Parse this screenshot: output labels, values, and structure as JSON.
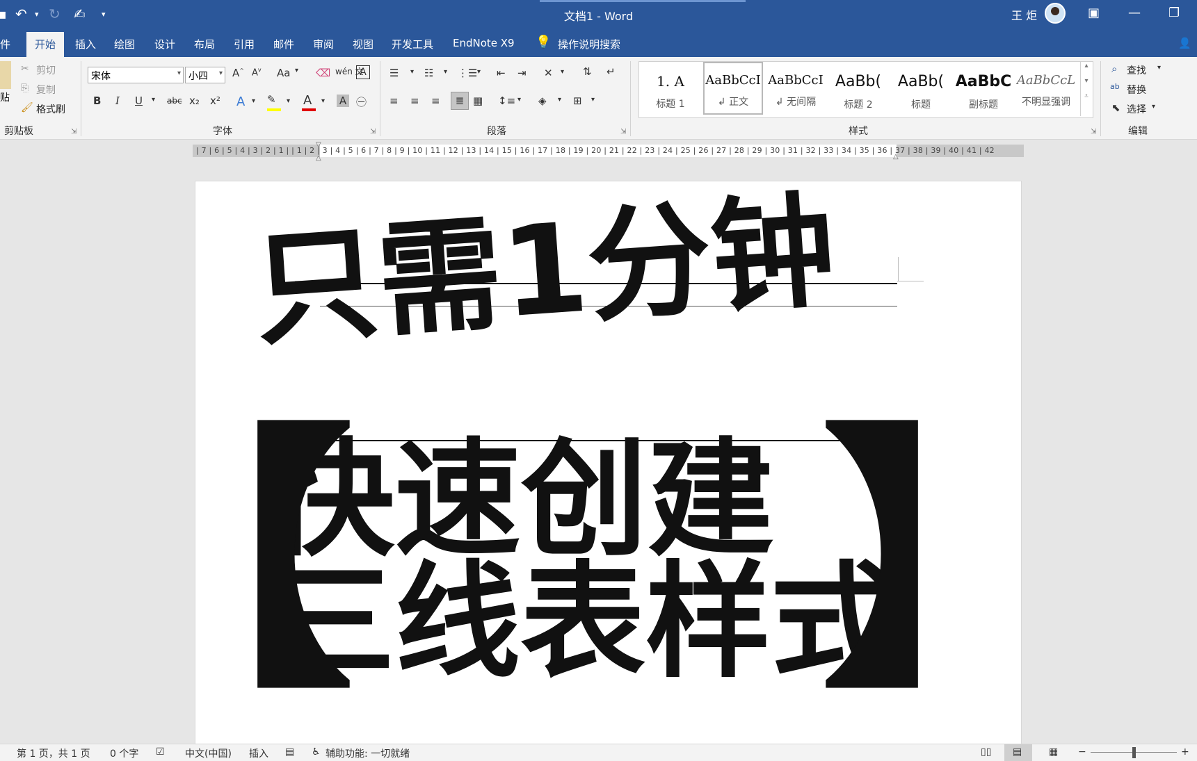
{
  "titlebar": {
    "doc_title": "文档1  -  Word",
    "user_name": "王 炬",
    "qa_save_icon": "save-icon",
    "qa_undo_icon": "undo-icon",
    "qa_redo_icon": "redo-icon",
    "qa_touch_icon": "touch-mode-icon",
    "qa_more": "▾",
    "min_glyph": "—",
    "restore_glyph": "❐"
  },
  "tabs": [
    "件",
    "开始",
    "插入",
    "绘图",
    "设计",
    "布局",
    "引用",
    "邮件",
    "审阅",
    "视图",
    "开发工具",
    "EndNote X9",
    "操作说明搜索"
  ],
  "clipboard": {
    "paste": "贴",
    "cut": "剪切",
    "copy": "复制",
    "format_painter": "格式刷",
    "label": "剪贴板"
  },
  "font": {
    "name": "宋体",
    "size": "小四",
    "label": "字体",
    "grow": "A",
    "shrink": "A",
    "case": "Aa",
    "bold": "B",
    "italic": "I",
    "underline": "U",
    "strike": "abc",
    "sub": "x₂",
    "sup": "x²",
    "color_a": "A",
    "shade_a": "A",
    "border_a": "A",
    "phonetic": "wén 文",
    "enclose": "㊀"
  },
  "paragraph": {
    "label": "段落"
  },
  "styles": {
    "label": "样式",
    "items": [
      {
        "sample": "1.   A",
        "name": "标题 1"
      },
      {
        "sample": "AaBbCcI",
        "name": "↲ 正文"
      },
      {
        "sample": "AaBbCcI",
        "name": "↲ 无间隔"
      },
      {
        "sample": "AaBb(",
        "name": "标题 2"
      },
      {
        "sample": "AaBb(",
        "name": "标题"
      },
      {
        "sample": "AaBbC",
        "name": "副标题"
      },
      {
        "sample": "AaBbCcL",
        "name": "不明显强调"
      }
    ]
  },
  "editing": {
    "find": "查找",
    "replace": "替换",
    "select": "选择",
    "label": "编辑"
  },
  "ruler": {
    "text": "| 7 | 6 | 5 | 4 | 3 | 2 | 1 |   | 1 | 2 | 3 | 4 | 5 | 6 | 7 | 8 | 9 | 10 | 11 | 12 | 13 | 14 | 15 | 16 | 17 | 18 | 19 | 20 | 21 | 22 | 23 | 24 | 25 | 26 | 27 | 28 | 29 | 30 | 31 | 32 | 33 | 34 | 35 | 36 | 37 | 38 | 39 | 40 | 41 | 42"
  },
  "document": {
    "line1": "只需1分钟",
    "line2": "快速创建",
    "line3": "三线表样式",
    "bracket_left": "【",
    "bracket_right": "】"
  },
  "statusbar": {
    "page": "第 1 页，共 1 页",
    "words": "0 个字",
    "lang": "中文(中国)",
    "mode": "插入",
    "accessibility": "辅助功能: 一切就绪",
    "zoom_minus": "−",
    "zoom_plus": "+"
  },
  "colors": {
    "brand": "#2b579a",
    "ribbon": "#f3f3f3",
    "font_color_bar": "#e00000",
    "highlight_bar": "#ffff00"
  }
}
